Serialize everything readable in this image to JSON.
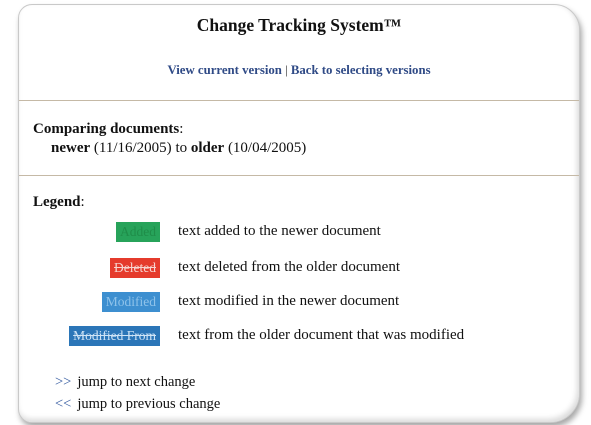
{
  "header": {
    "title": "Change Tracking System™",
    "view_current_label": "View current version",
    "separator": "|",
    "back_label": "Back to selecting versions"
  },
  "comparison": {
    "label": "Comparing documents",
    "label_colon": ":",
    "newer_word": "newer",
    "newer_date": "(11/16/2005)",
    "to_word": "to",
    "older_word": "older",
    "older_date": "(10/04/2005)"
  },
  "legend": {
    "label": "Legend",
    "label_colon": ":",
    "items": [
      {
        "swatch": "Added",
        "description": "text added to the newer document",
        "color": "#27a35a"
      },
      {
        "swatch": "Deleted",
        "description": "text deleted from the older document",
        "color": "#e53b2c"
      },
      {
        "swatch": "Modified",
        "description": "text modified in the newer document",
        "color": "#3d8fd0"
      },
      {
        "swatch": "Modified From",
        "description": "text from the older document that was modified",
        "color": "#2b76b8"
      }
    ]
  },
  "navigation": {
    "next_arrow": ">>",
    "next_label": "jump to next change",
    "prev_arrow": "<<",
    "prev_label": "jump to previous change"
  }
}
